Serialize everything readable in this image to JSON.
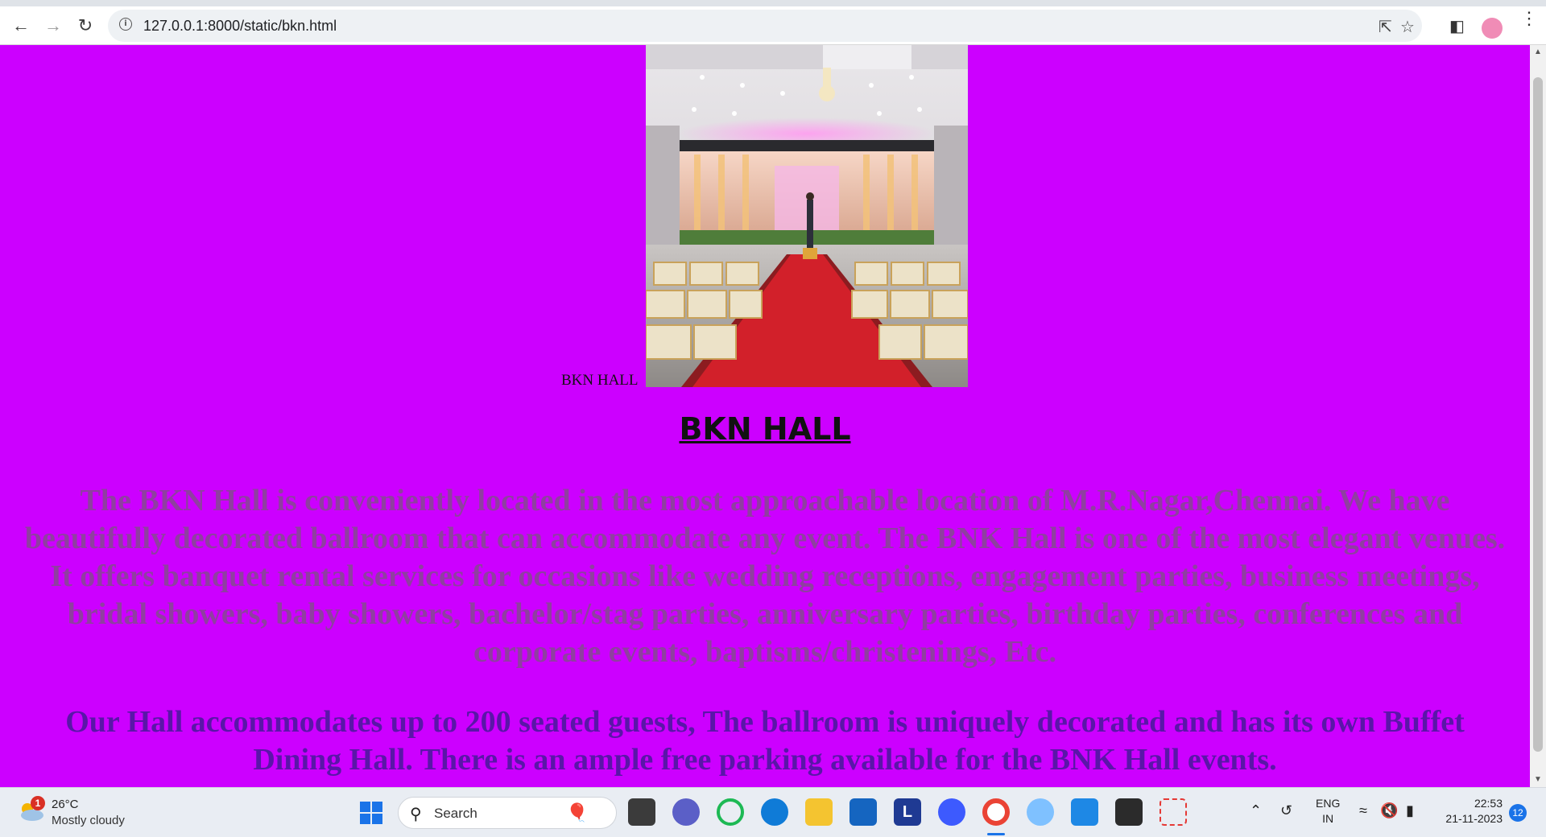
{
  "browser": {
    "url": "127.0.0.1:8000/static/bkn.html"
  },
  "page": {
    "hero_caption": "BKN HALL",
    "heading": "BKN HALL",
    "paragraph1": "The BKN Hall is conveniently located in the most approachable location of M.R.Nagar,Chennai. We have beautifully decorated ballroom that can accommodate any event. The BNK Hall is one of the most elegant venues. It offers banquet rental services for occasions like wedding receptions, engagement parties, business meetings, bridal showers, baby showers, bachelor/stag parties, anniversary parties, birthday parties, conferences and corporate events, baptisms/christenings, Etc.",
    "paragraph2": "Our Hall accommodates up to 200 seated guests, The ballroom is uniquely decorated and has its own Buffet Dining Hall. There is an ample free parking available for the BNK Hall events.",
    "background_color": "#cc00ff"
  },
  "taskbar": {
    "weather_badge": "1",
    "temperature": "26°C",
    "condition": "Mostly cloudy",
    "search_label": "Search",
    "lang_top": "ENG",
    "lang_bottom": "IN",
    "time": "22:53",
    "date": "21-11-2023",
    "notification_count": "12"
  }
}
